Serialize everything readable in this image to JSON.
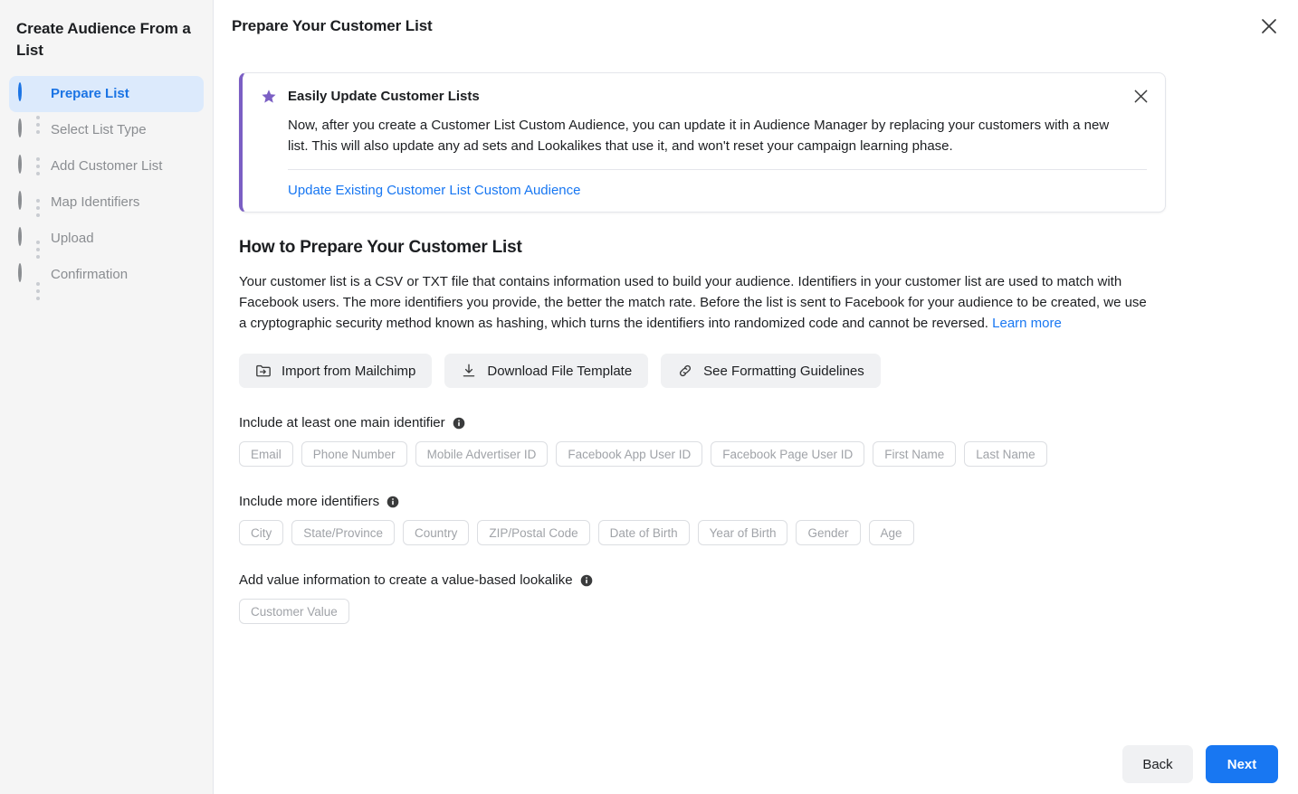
{
  "sidebar": {
    "title": "Create Audience From a List",
    "steps": [
      {
        "label": "Prepare List",
        "state": "active",
        "icon": "half-filled-circle-icon"
      },
      {
        "label": "Select List Type",
        "state": "pending",
        "icon": "empty-circle-icon"
      },
      {
        "label": "Add Customer List",
        "state": "pending",
        "icon": "empty-circle-icon"
      },
      {
        "label": "Map Identifiers",
        "state": "pending",
        "icon": "empty-circle-icon"
      },
      {
        "label": "Upload",
        "state": "pending",
        "icon": "empty-circle-icon"
      },
      {
        "label": "Confirmation",
        "state": "pending",
        "icon": "empty-circle-icon"
      }
    ]
  },
  "header": {
    "title": "Prepare Your Customer List",
    "close_icon": "close-icon"
  },
  "banner": {
    "icon": "star-icon",
    "accent_color": "#7b5fc4",
    "title": "Easily Update Customer Lists",
    "body": "Now, after you create a Customer List Custom Audience, you can update it in Audience Manager by replacing your customers with a new list. This will also update any ad sets and Lookalikes that use it, and won't reset your campaign learning phase.",
    "link": "Update Existing Customer List Custom Audience",
    "close_icon": "close-icon"
  },
  "main": {
    "section_title": "How to Prepare Your Customer List",
    "paragraph": "Your customer list is a CSV or TXT file that contains information used to build your audience. Identifiers in your customer list are used to match with Facebook users. The more identifiers you provide, the better the match rate. Before the list is sent to Facebook for your audience to be created, we use a cryptographic security method known as hashing, which turns the identifiers into randomized code and cannot be reversed.",
    "paragraph_link": "Learn more",
    "actions": [
      {
        "label": "Import from Mailchimp",
        "icon": "folder-import-icon"
      },
      {
        "label": "Download File Template",
        "icon": "download-icon"
      },
      {
        "label": "See Formatting Guidelines",
        "icon": "link-icon"
      }
    ],
    "groups": [
      {
        "label": "Include at least one main identifier",
        "info_icon": "info-icon",
        "chips": [
          "Email",
          "Phone Number",
          "Mobile Advertiser ID",
          "Facebook App User ID",
          "Facebook Page User ID",
          "First Name",
          "Last Name"
        ]
      },
      {
        "label": "Include more identifiers",
        "info_icon": "info-icon",
        "chips": [
          "City",
          "State/Province",
          "Country",
          "ZIP/Postal Code",
          "Date of Birth",
          "Year of Birth",
          "Gender",
          "Age"
        ]
      },
      {
        "label": "Add value information to create a value-based lookalike",
        "info_icon": "info-icon",
        "chips": [
          "Customer Value"
        ]
      }
    ]
  },
  "footer": {
    "back_label": "Back",
    "next_label": "Next",
    "primary_color": "#1877f2"
  }
}
